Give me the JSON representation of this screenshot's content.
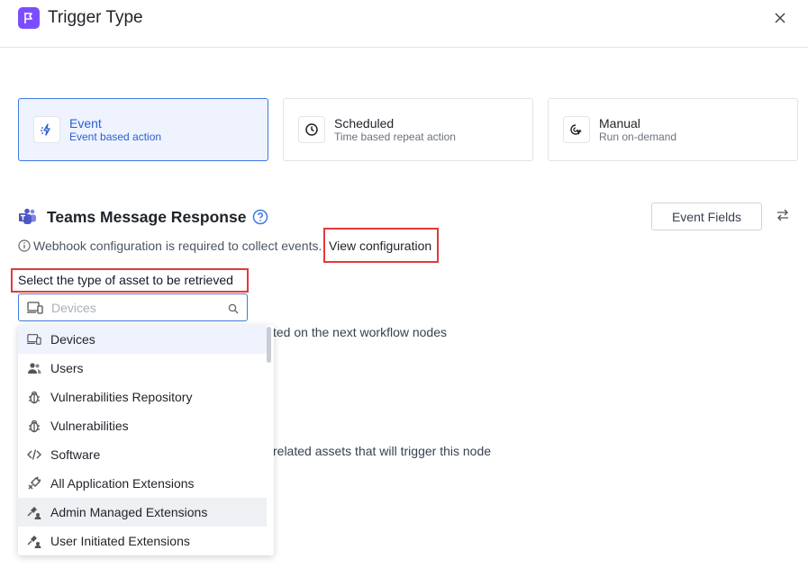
{
  "header": {
    "title": "Trigger Type",
    "app_icon": "flag-icon",
    "close_icon": "close-icon"
  },
  "trigger_types": [
    {
      "label": "Event",
      "description": "Event based action",
      "icon": "event-lightning-icon",
      "selected": true
    },
    {
      "label": "Scheduled",
      "description": "Time based repeat action",
      "icon": "clock-icon",
      "selected": false
    },
    {
      "label": "Manual",
      "description": "Run on-demand",
      "icon": "cursor-click-icon",
      "selected": false
    }
  ],
  "section": {
    "title": "Teams Message Response",
    "event_fields_label": "Event Fields",
    "info_text": "Webhook configuration is required to collect events.",
    "view_configuration_label": "View configuration"
  },
  "asset": {
    "label": "Select the type of asset to be retrieved",
    "search_placeholder": "Devices"
  },
  "background": {
    "line1": "ted on the next workflow nodes",
    "line2": "related assets that will trigger this node"
  },
  "dropdown_items": [
    {
      "label": "Devices",
      "icon": "devices-icon"
    },
    {
      "label": "Users",
      "icon": "users-icon"
    },
    {
      "label": "Vulnerabilities Repository",
      "icon": "bug-icon"
    },
    {
      "label": "Vulnerabilities",
      "icon": "bug-icon"
    },
    {
      "label": "Software",
      "icon": "code-icon"
    },
    {
      "label": "All Application Extensions",
      "icon": "plug-icon"
    },
    {
      "label": "Admin Managed Extensions",
      "icon": "admin-extension-icon"
    },
    {
      "label": "User Initiated Extensions",
      "icon": "user-extension-icon"
    }
  ],
  "colors": {
    "accent": "#3d7be0",
    "brand": "#7c4dff",
    "highlight": "#e23b3b"
  }
}
